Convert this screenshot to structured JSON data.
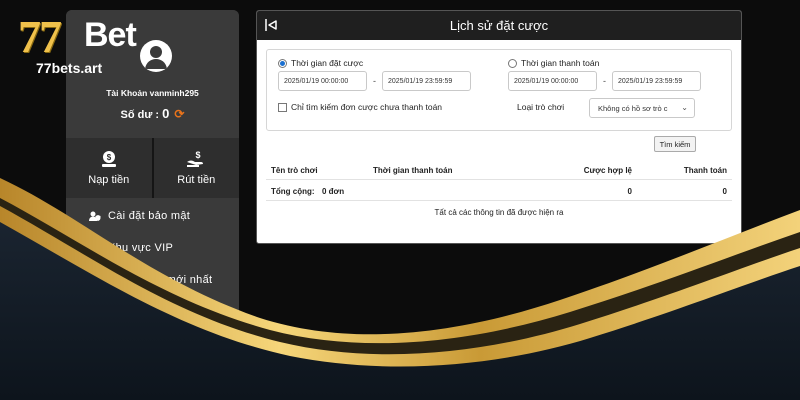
{
  "brand": {
    "logo_digits": "77",
    "logo_word": "Bet",
    "site": "77bets.art"
  },
  "account": {
    "name_label": "Tài Khoản vanminh295",
    "balance_label": "Số dư :",
    "balance_value": "0"
  },
  "actions": [
    {
      "label": "Nạp tiền",
      "icon": "deposit-money-icon"
    },
    {
      "label": "Rút tiền",
      "icon": "withdraw-money-icon"
    }
  ],
  "menu": [
    {
      "label": "Cài đặt bảo mật",
      "icon": "user-shield-icon"
    },
    {
      "label": "Khu vực VIP",
      "icon": "crown-icon"
    },
    {
      "label": "Thông báo mới nhất",
      "icon": "bell-icon"
    }
  ],
  "dialog": {
    "title": "Lịch sử đặt cược",
    "bet_time_label": "Thời gian đặt cược",
    "bet_time_selected": true,
    "bet_from": "2025/01/19 00:00:00",
    "bet_to": "2025/01/19 23:59:59",
    "pay_time_label": "Thời gian thanh toán",
    "pay_from": "2025/01/19 00:00:00",
    "pay_to": "2025/01/19 23:59:59",
    "dash": "-",
    "unpaid_only_label": "Chỉ tìm kiếm đơn cược chưa thanh toán",
    "game_type_label": "Loại trò chơi",
    "game_type_value": "Không có hồ sơ trò c",
    "search_label": "Tìm kiếm"
  },
  "table": {
    "headers": [
      "Tên trò chơi",
      "Thời gian thanh toán",
      "Cược hợp lệ",
      "Thanh toán"
    ],
    "total_label": "Tổng cộng:",
    "total_orders": "0 đơn",
    "total_valid_bet": "0",
    "total_payout": "0",
    "footer_note": "Tất cả các thông tin đã được hiện ra"
  },
  "colors": {
    "accent_gold": "#f0c14b",
    "refresh_orange": "#e8731b",
    "dialog_header": "#1f1f1f"
  }
}
